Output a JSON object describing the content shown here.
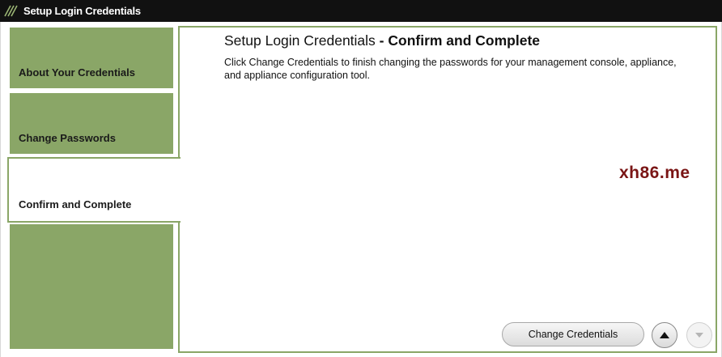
{
  "window": {
    "title": "Setup Login Credentials",
    "logo_icon": "striped-logo-icon"
  },
  "nav": {
    "items": [
      {
        "label": "About Your Credentials",
        "active": false
      },
      {
        "label": "Change Passwords",
        "active": false
      },
      {
        "label": "Confirm and Complete",
        "active": true
      }
    ]
  },
  "main": {
    "heading_prefix": "Setup Login Credentials",
    "heading_step": "- Confirm and Complete",
    "description": "Click Change Credentials to finish changing the passwords for your management console, appliance, and appliance configuration tool.",
    "watermark": "xh86.me"
  },
  "actions": {
    "change_label": "Change Credentials",
    "up_icon": "triangle-up-icon",
    "down_icon": "triangle-down-icon"
  },
  "colors": {
    "accent": "#8aa667",
    "titlebar": "#111111",
    "watermark": "#7a1515"
  }
}
